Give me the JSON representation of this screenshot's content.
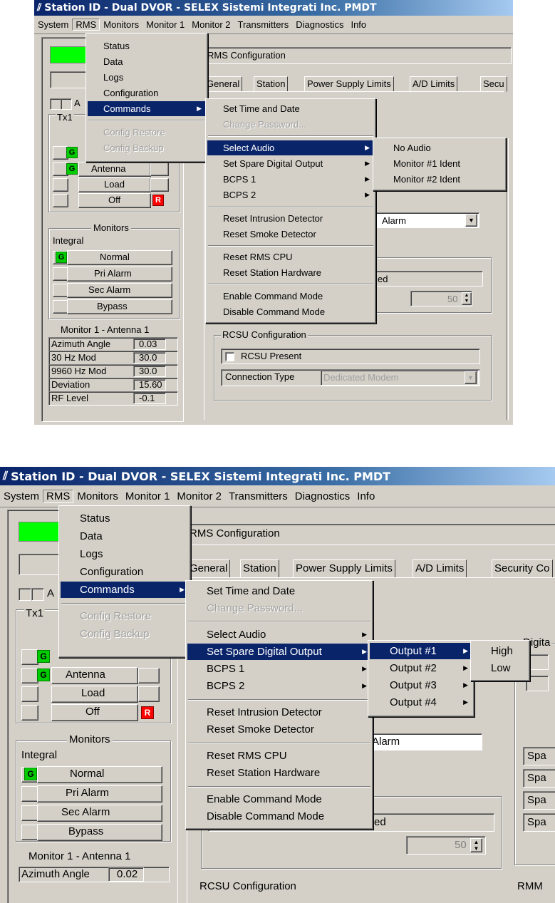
{
  "window": {
    "title": "Station ID - Dual DVOR - SELEX Sistemi Integrati Inc. PMDT",
    "logo_icon": "antenna-logo-icon"
  },
  "menubar": [
    "System",
    "RMS",
    "Monitors",
    "Monitor 1",
    "Monitor 2",
    "Transmitters",
    "Diagnostics",
    "Info"
  ],
  "rms_menu": {
    "items": [
      "Status",
      "Data",
      "Logs",
      "Configuration",
      "Commands",
      "Config Restore",
      "Config Backup"
    ]
  },
  "commands_menu": {
    "items": [
      "Set Time and Date",
      "Change Password...",
      "Select Audio",
      "Set Spare Digital Output",
      "BCPS 1",
      "BCPS 2",
      "Reset Intrusion Detector",
      "Reset Smoke Detector",
      "Reset RMS CPU",
      "Reset Station Hardware",
      "Enable Command Mode",
      "Disable Command Mode"
    ]
  },
  "audio_menu": {
    "items": [
      "No Audio",
      "Monitor #1 Ident",
      "Monitor #2 Ident"
    ]
  },
  "output_menu": {
    "items": [
      "Output #1",
      "Output #2",
      "Output #3",
      "Output #4"
    ]
  },
  "level_menu": {
    "items": [
      "High",
      "Low"
    ]
  },
  "rms_config": {
    "title": "RMS Configuration",
    "tabs_top": [
      "General",
      "Station",
      "Power Supply Limits",
      "A/D Limits",
      "Secu"
    ],
    "tabs_bottom": [
      "General",
      "Station",
      "Power Supply Limits",
      "A/D Limits",
      "Security Co"
    ],
    "alarm_text": "Alarm",
    "alarm_text_bottom": "Alarm",
    "ed_text": "ed",
    "spin_value": "50",
    "rcsu_group": "RCSU Configuration",
    "rcsu_present": "RCSU Present",
    "connection_type_label": "Connection Type",
    "connection_type_value": "Dedicated Modem",
    "digital_group": "Digita",
    "spare_label": "Spa",
    "rmm_group": "RMM"
  },
  "left_panel": {
    "a_label": "A",
    "tx_label": "Tx1",
    "g": "G",
    "r": "R",
    "antenna": "Antenna",
    "load": "Load",
    "off": "Off",
    "monitors_group": "Monitors",
    "integral": "Integral",
    "normal": "Normal",
    "pri_alarm": "Pri Alarm",
    "sec_alarm": "Sec Alarm",
    "bypass": "Bypass",
    "monitor_title": "Monitor 1 - Antenna 1",
    "params": [
      {
        "label": "Azimuth Angle",
        "value": "0.03"
      },
      {
        "label": "30 Hz Mod",
        "value": "30.0"
      },
      {
        "label": "9960 Hz Mod",
        "value": "30.0"
      },
      {
        "label": "Deviation",
        "value": "15.60"
      },
      {
        "label": "RF Level",
        "value": "-0.1"
      }
    ],
    "azimuth_bottom_label": "Azimuth Angle",
    "azimuth_bottom_value": "0.02"
  },
  "colors": {
    "title_start": "#0a246a",
    "title_end": "#a6caf0",
    "menu_highlight": "#0a246a",
    "status_green": "#00ff00",
    "alarm_red": "#ff0000"
  }
}
